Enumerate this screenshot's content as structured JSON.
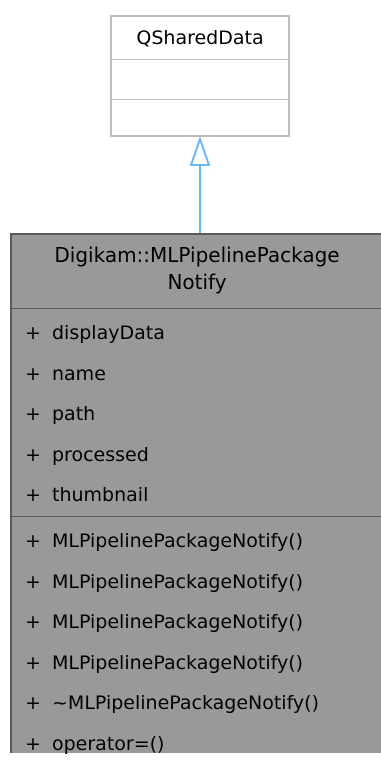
{
  "base_class": {
    "name": "QSharedData"
  },
  "main_class": {
    "name_line1": "Digikam::MLPipelinePackage",
    "name_line2": "Notify",
    "attributes": [
      {
        "visibility": "+",
        "name": "displayData"
      },
      {
        "visibility": "+",
        "name": "name"
      },
      {
        "visibility": "+",
        "name": "path"
      },
      {
        "visibility": "+",
        "name": "processed"
      },
      {
        "visibility": "+",
        "name": "thumbnail"
      }
    ],
    "methods": [
      {
        "visibility": "+",
        "name": "MLPipelinePackageNotify()"
      },
      {
        "visibility": "+",
        "name": "MLPipelinePackageNotify()"
      },
      {
        "visibility": "+",
        "name": "MLPipelinePackageNotify()"
      },
      {
        "visibility": "+",
        "name": "MLPipelinePackageNotify()"
      },
      {
        "visibility": "+",
        "name": "~MLPipelinePackageNotify()"
      },
      {
        "visibility": "+",
        "name": "operator=()"
      }
    ]
  },
  "colors": {
    "arrow": "#63b8ff",
    "main_fill": "#999999",
    "main_border": "#5a5a5a",
    "base_border": "#bdbdbd"
  },
  "relationship": "inheritance-arrow-icon"
}
